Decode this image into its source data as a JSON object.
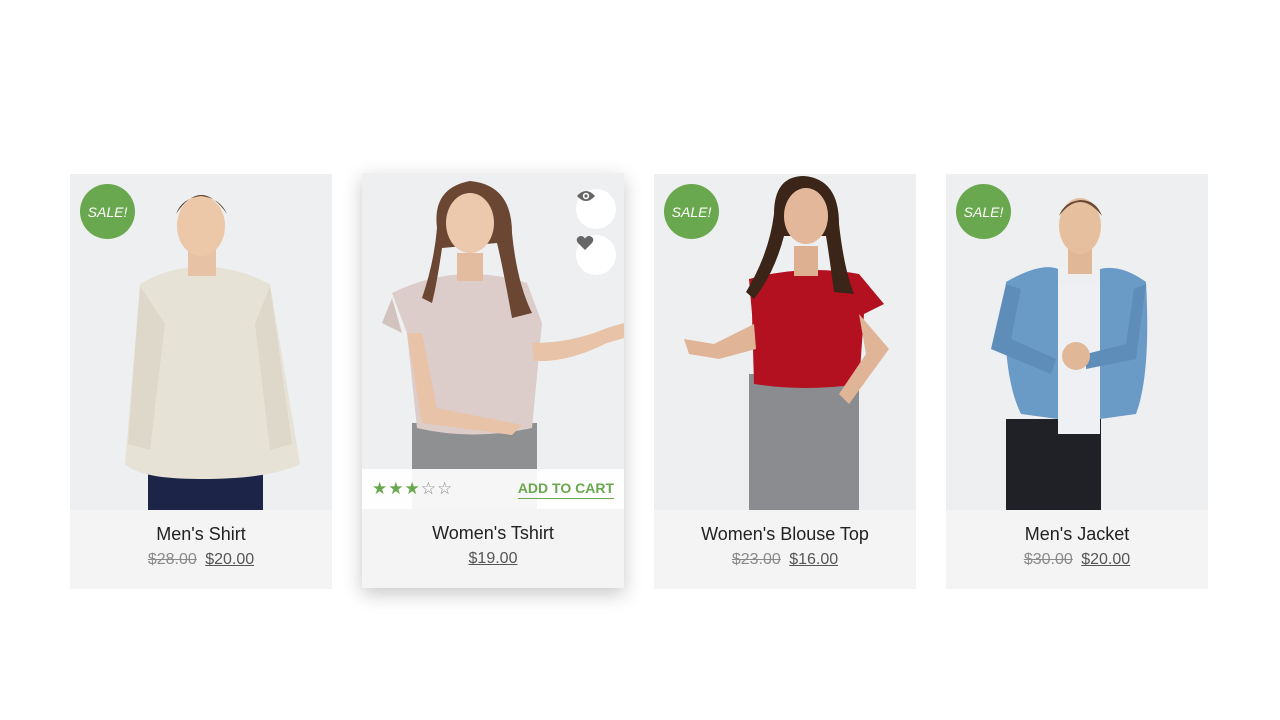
{
  "products": [
    {
      "name": "Men's Shirt",
      "old_price": "$28.00",
      "price": "$20.00",
      "badge": "SALE!",
      "image": "man-in-linen-shirt"
    },
    {
      "name": "Women's Tshirt",
      "price": "$19.00",
      "image": "woman-in-pink-tshirt",
      "rating": 3,
      "rating_max": 5,
      "add_to_cart": "ADD TO CART",
      "quick_view_icon": "eye-icon",
      "wishlist_icon": "heart-icon"
    },
    {
      "name": "Women's Blouse Top",
      "old_price": "$23.00",
      "price": "$16.00",
      "badge": "SALE!",
      "image": "woman-in-red-blouse"
    },
    {
      "name": "Men's Jacket",
      "old_price": "$30.00",
      "price": "$20.00",
      "badge": "SALE!",
      "image": "man-in-denim-jacket"
    }
  ],
  "colors": {
    "accent": "#6aa84f",
    "card_bg": "#f4f4f4",
    "photo_bg": "#eeeff1"
  }
}
